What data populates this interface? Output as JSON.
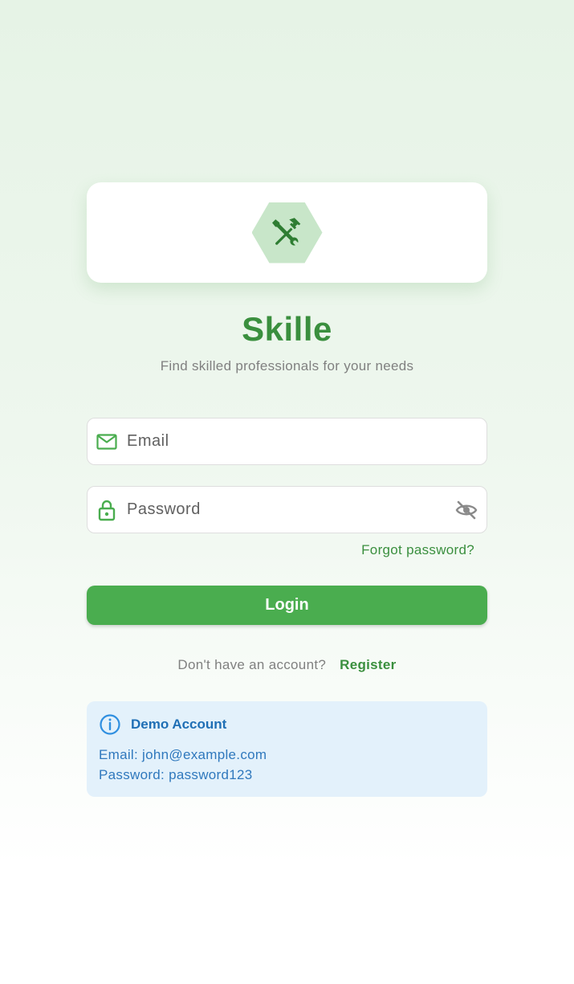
{
  "app": {
    "title": "Skille",
    "subtitle": "Find skilled professionals for your needs",
    "logo_icon": "hammer-wrench-icon"
  },
  "form": {
    "email_placeholder": "Email",
    "email_value": "",
    "email_icon": "mail-icon",
    "password_placeholder": "Password",
    "password_value": "",
    "password_icon": "lock-icon",
    "visibility_icon": "eye-off-icon",
    "forgot_label": "Forgot password?",
    "login_label": "Login"
  },
  "register": {
    "question": "Don't have an account?",
    "link_label": "Register"
  },
  "demo": {
    "icon": "info-icon",
    "title": "Demo Account",
    "email_line": "Email: john@example.com",
    "password_line": "Password: password123"
  },
  "colors": {
    "brand_green": "#3a8f3e",
    "button_green": "#4aad4f",
    "logo_bg": "#c8e6c9",
    "info_bg": "#e3f1fb",
    "info_text": "#1f6fb5"
  }
}
